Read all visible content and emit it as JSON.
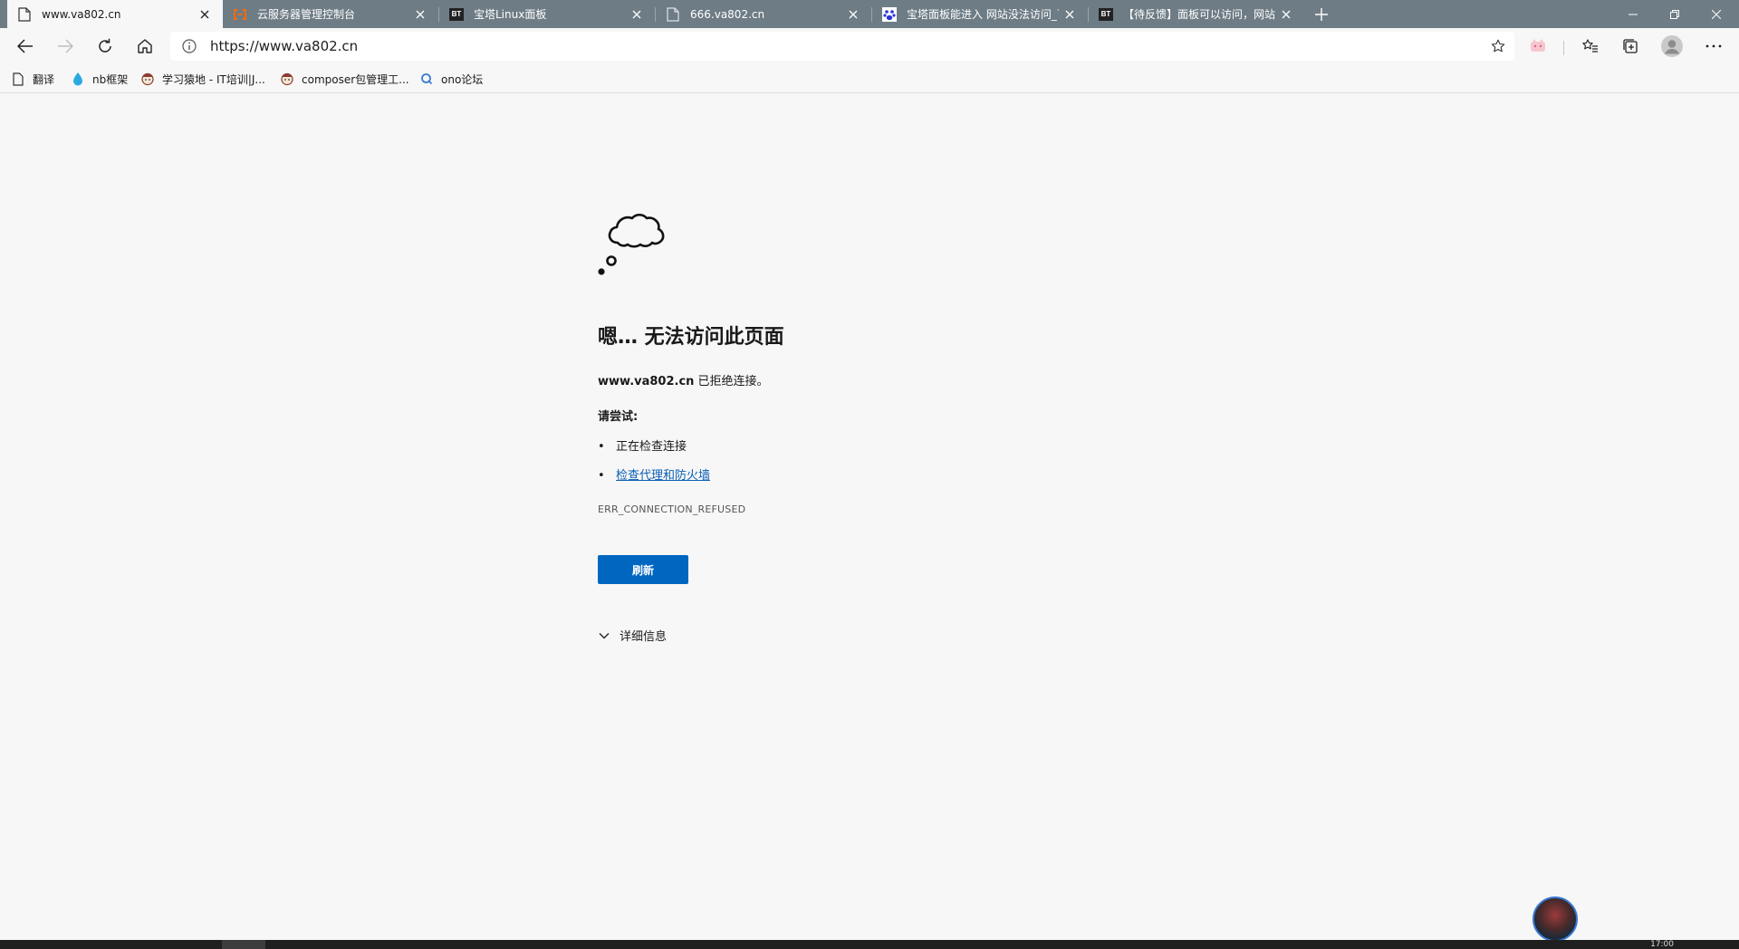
{
  "tabs": [
    {
      "title": "www.va802.cn",
      "active": true,
      "icon": "page-icon"
    },
    {
      "title": "云服务器管理控制台",
      "active": false,
      "icon": "aliyun-icon"
    },
    {
      "title": "宝塔Linux面板",
      "active": false,
      "icon": "bt-icon"
    },
    {
      "title": "666.va802.cn",
      "active": false,
      "icon": "page-icon"
    },
    {
      "title": "宝塔面板能进入 网站没法访问_百",
      "active": false,
      "icon": "baidu-paw-icon"
    },
    {
      "title": "【待反馈】面板可以访问，网站",
      "active": false,
      "icon": "bt-icon"
    }
  ],
  "bt_badge": "BT",
  "address_bar": {
    "url": "https://www.va802.cn"
  },
  "bookmarks": [
    {
      "label": "翻译",
      "icon": "page-icon"
    },
    {
      "label": "nb框架",
      "icon": "drop-icon"
    },
    {
      "label": "学习猿地 - IT培训|J...",
      "icon": "monkey-icon"
    },
    {
      "label": "composer包管理工...",
      "icon": "monkey-icon"
    },
    {
      "label": "ono论坛",
      "icon": "search-q-icon"
    }
  ],
  "error": {
    "title": "嗯… 无法访问此页面",
    "host": "www.va802.cn",
    "host_suffix": " 已拒绝连接。",
    "try_label": "请尝试:",
    "suggestions": [
      {
        "text": "正在检查连接",
        "link": false
      },
      {
        "text": "检查代理和防火墙",
        "link": true
      }
    ],
    "code": "ERR_CONNECTION_REFUSED",
    "refresh_label": "刷新",
    "details_label": "详细信息"
  },
  "taskbar": {
    "clock": "17:00"
  },
  "colors": {
    "tabstrip": "#6e7c85",
    "page_bg": "#f7f7f7",
    "accent": "#0067c0",
    "link": "#0a5fb4"
  }
}
